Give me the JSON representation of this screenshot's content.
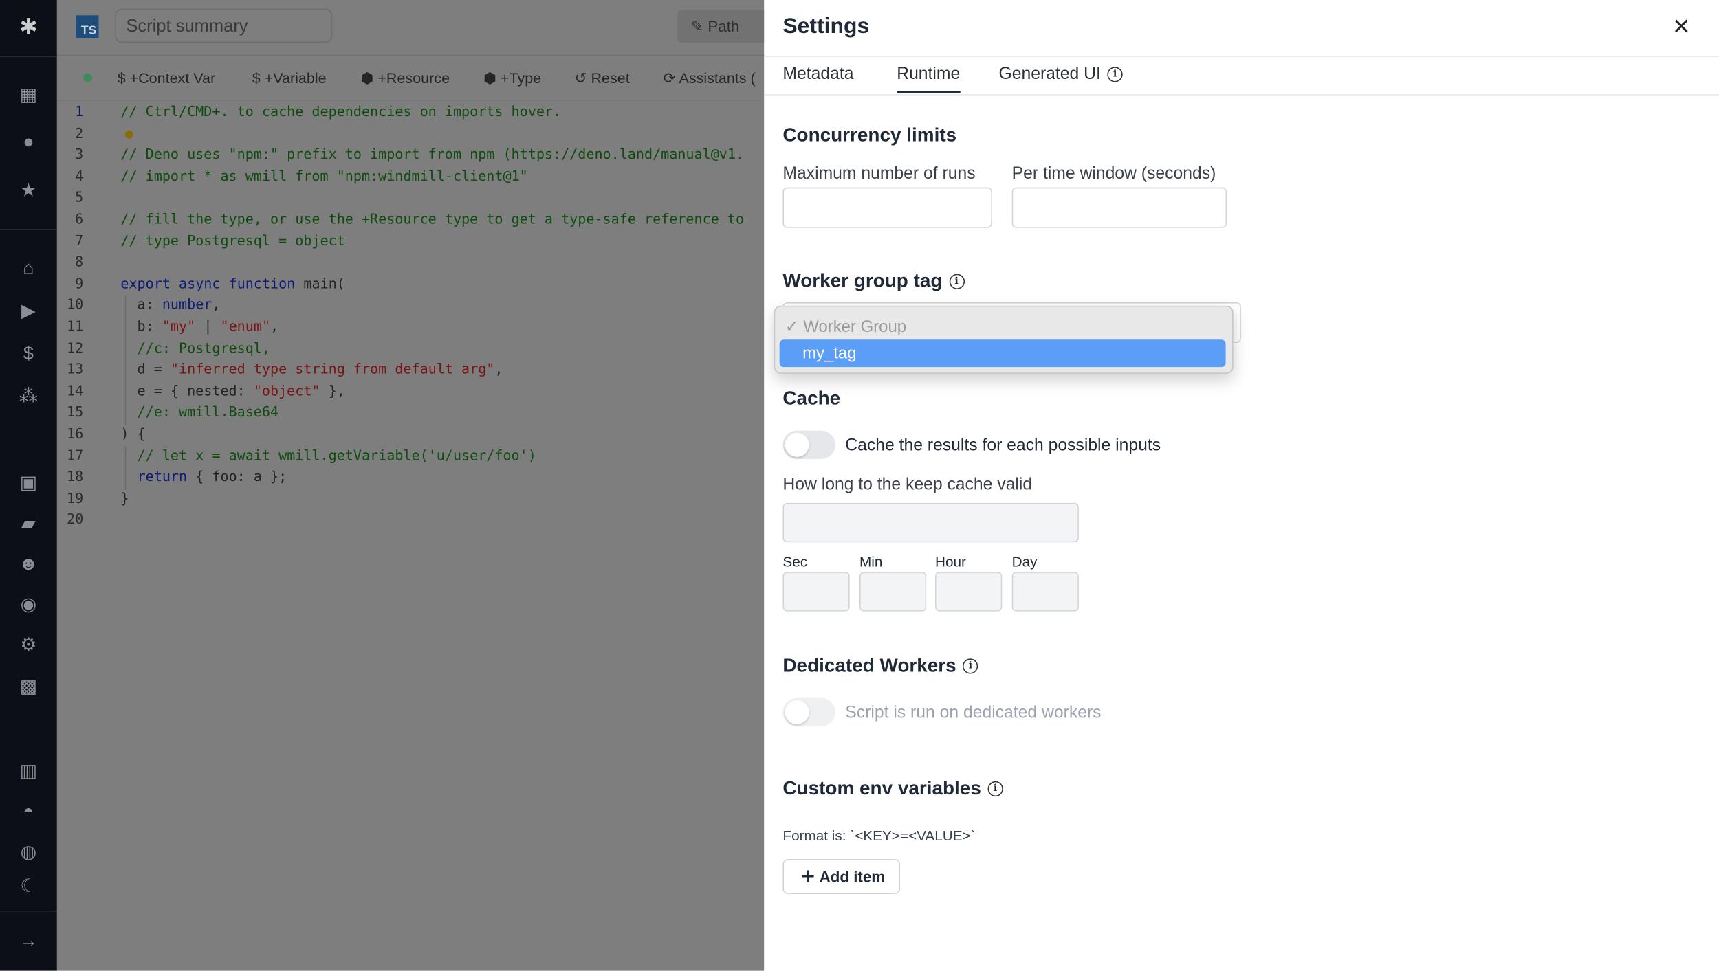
{
  "sidebar": {
    "icons": [
      "windmill-logo",
      "building-icon",
      "user-icon",
      "star-icon",
      "home-icon",
      "play-icon",
      "dollar-icon",
      "cubes-icon",
      "calendar-icon",
      "folder-icon",
      "users-icon",
      "eye-icon",
      "gear-icon",
      "robot-icon",
      "book-icon",
      "discord-icon",
      "github-icon",
      "moon-icon",
      "arrow-right-icon"
    ]
  },
  "header": {
    "language_badge": "TS",
    "summary_placeholder": "Script summary",
    "path_label": "Path"
  },
  "toolbar": {
    "context_var": "$ +Context Var",
    "variable": "$ +Variable",
    "resource": "+Resource",
    "type": "+Type",
    "reset": "Reset",
    "assistants": "Assistants ("
  },
  "editor": {
    "lines": [
      "// Ctrl/CMD+. to cache dependencies on imports hover.",
      "",
      "// Deno uses \"npm:\" prefix to import from npm (https://deno.land/manual@v1.",
      "// import * as wmill from \"npm:windmill-client@1\"",
      "",
      "// fill the type, or use the +Resource type to get a type-safe reference to",
      "// type Postgresql = object",
      "",
      "export async function main(",
      "  a: number,",
      "  b: \"my\" | \"enum\",",
      "  //c: Postgresql,",
      "  d = \"inferred type string from default arg\",",
      "  e = { nested: \"object\" },",
      "  //e: wmill.Base64",
      ") {",
      "  // let x = await wmill.getVariable('u/user/foo')",
      "  return { foo: a };",
      "}",
      ""
    ],
    "line_numbers": [
      "1",
      "2",
      "3",
      "4",
      "5",
      "6",
      "7",
      "8",
      "9",
      "10",
      "11",
      "12",
      "13",
      "14",
      "15",
      "16",
      "17",
      "18",
      "19",
      "20"
    ]
  },
  "settings": {
    "title": "Settings",
    "tabs": [
      {
        "label": "Metadata",
        "active": false
      },
      {
        "label": "Runtime",
        "active": true
      },
      {
        "label": "Generated UI",
        "active": false
      }
    ],
    "concurrency": {
      "heading": "Concurrency limits",
      "max_runs_label": "Maximum number of runs",
      "max_runs_value": "",
      "time_window_label": "Per time window (seconds)",
      "time_window_value": ""
    },
    "worker_group": {
      "heading": "Worker group tag",
      "options": [
        "Worker Group",
        "my_tag"
      ],
      "checked": "Worker Group",
      "highlighted": "my_tag"
    },
    "cache": {
      "heading": "Cache",
      "toggle_label": "Cache the results for each possible inputs",
      "enabled": false,
      "duration_label": "How long to the keep cache valid",
      "units": [
        "Sec",
        "Min",
        "Hour",
        "Day"
      ]
    },
    "dedicated": {
      "heading": "Dedicated Workers",
      "toggle_label": "Script is run on dedicated workers",
      "enabled": false
    },
    "env": {
      "heading": "Custom env variables",
      "format": "Format is: `<KEY>=<VALUE>`",
      "add_label": "Add item"
    }
  },
  "colors": {
    "accent": "#5b9ef7",
    "sidebar": "#0c0f15"
  }
}
